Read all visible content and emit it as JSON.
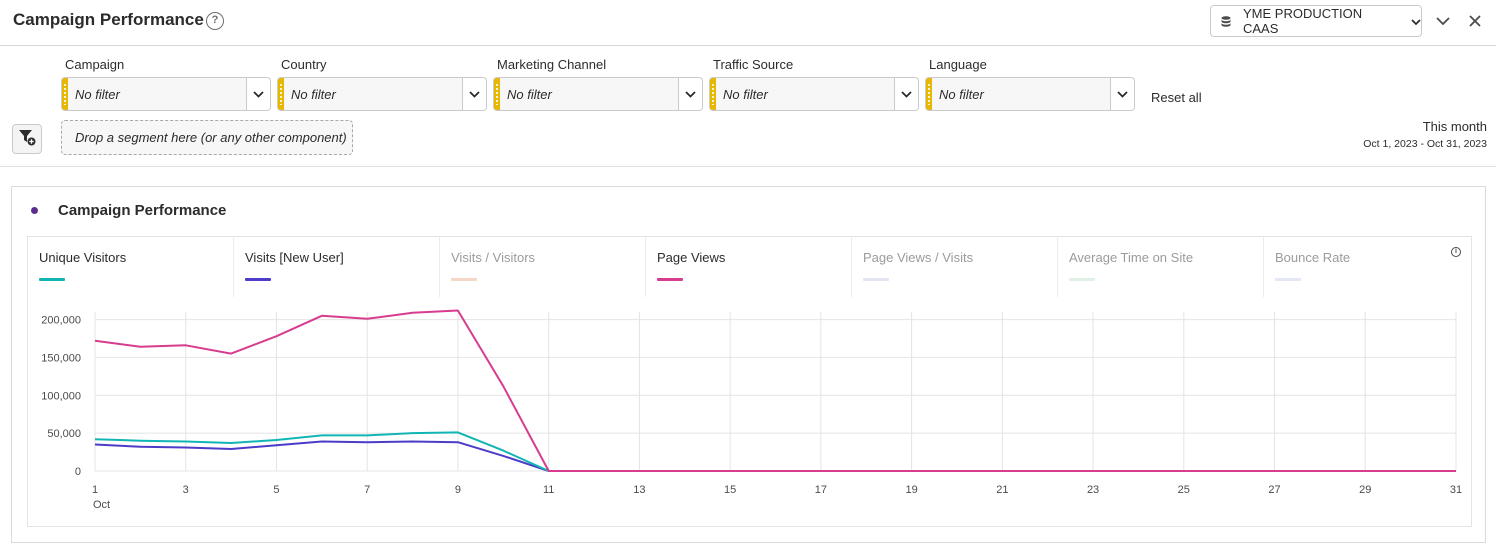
{
  "header": {
    "title": "Campaign Performance",
    "help_icon_glyph": "?",
    "report_suite": "YME PRODUCTION CAAS",
    "icons": [
      "help-icon",
      "database-icon",
      "chevron-down-icon",
      "close-icon"
    ]
  },
  "filters": [
    {
      "label": "Campaign",
      "value": "No filter"
    },
    {
      "label": "Country",
      "value": "No filter"
    },
    {
      "label": "Marketing Channel",
      "value": "No filter"
    },
    {
      "label": "Traffic Source",
      "value": "No filter"
    },
    {
      "label": "Language",
      "value": "No filter"
    }
  ],
  "reset_all": "Reset all",
  "segment_drop": "Drop a segment here (or any other component)",
  "date": {
    "label": "This month",
    "range": "Oct 1, 2023 - Oct 31, 2023"
  },
  "panel": {
    "title": "Campaign Performance",
    "accent": "#5c2d91",
    "info_glyph": "i",
    "metrics": [
      {
        "label": "Unique Visitors",
        "color": "#12b5b5",
        "active": true
      },
      {
        "label": "Visits [New User]",
        "color": "#4c3cc7",
        "active": true
      },
      {
        "label": "Visits / Visitors",
        "color": "#f5d7c8",
        "active": false
      },
      {
        "label": "Page Views",
        "color": "#d83c8e",
        "active": true
      },
      {
        "label": "Page Views / Visits",
        "color": "#e3e6f0",
        "active": false
      },
      {
        "label": "Average Time on Site",
        "color": "#dff0e4",
        "active": false
      },
      {
        "label": "Bounce Rate",
        "color": "#e3e6f5",
        "active": false
      }
    ]
  },
  "chart_data": {
    "type": "line",
    "x": [
      1,
      2,
      3,
      4,
      5,
      6,
      7,
      8,
      9,
      10,
      11,
      12,
      13,
      14,
      15,
      16,
      17,
      18,
      19,
      20,
      21,
      22,
      23,
      24,
      25,
      26,
      27,
      28,
      29,
      30,
      31
    ],
    "x_ticks": [
      "1",
      "3",
      "5",
      "7",
      "9",
      "11",
      "13",
      "15",
      "17",
      "19",
      "21",
      "23",
      "25",
      "27",
      "29",
      "31"
    ],
    "x_sublabel": "Oct",
    "y_ticks": [
      "0",
      "50,000",
      "100,000",
      "150,000",
      "200,000"
    ],
    "ylim": [
      0,
      210000
    ],
    "grid": true,
    "series": [
      {
        "name": "Page Views",
        "color": "#d83c8e",
        "values": [
          172000,
          164000,
          166000,
          155000,
          178000,
          205000,
          201000,
          209000,
          212000,
          112000,
          0,
          0,
          0,
          0,
          0,
          0,
          0,
          0,
          0,
          0,
          0,
          0,
          0,
          0,
          0,
          0,
          0,
          0,
          0,
          0,
          0
        ]
      },
      {
        "name": "Unique Visitors",
        "color": "#12b5b5",
        "values": [
          42000,
          40000,
          39000,
          37000,
          41000,
          47000,
          47000,
          50000,
          51000,
          27000,
          0,
          0,
          0,
          0,
          0,
          0,
          0,
          0,
          0,
          0,
          0,
          0,
          0,
          0,
          0,
          0,
          0,
          0,
          0,
          0,
          0
        ]
      },
      {
        "name": "Visits [New User]",
        "color": "#4c3cc7",
        "values": [
          35000,
          32000,
          31000,
          29000,
          34000,
          39000,
          38000,
          39000,
          38000,
          20000,
          0,
          0,
          0,
          0,
          0,
          0,
          0,
          0,
          0,
          0,
          0,
          0,
          0,
          0,
          0,
          0,
          0,
          0,
          0,
          0,
          0
        ]
      }
    ]
  }
}
